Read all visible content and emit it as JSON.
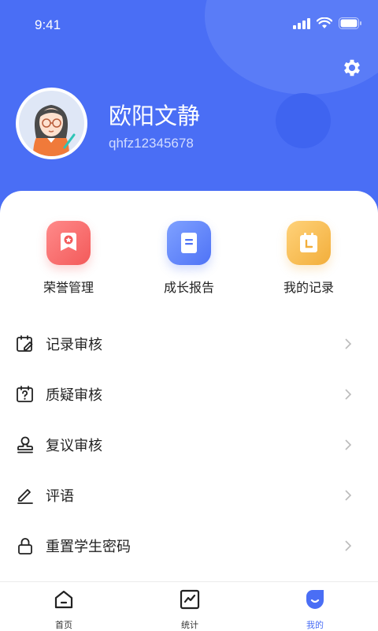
{
  "status": {
    "time": "9:41"
  },
  "profile": {
    "name": "欧阳文静",
    "id": "qhfz12345678"
  },
  "quick_actions": [
    {
      "label": "荣誉管理",
      "icon": "medal-icon",
      "color": "#f35a5a"
    },
    {
      "label": "成长报告",
      "icon": "report-icon",
      "color": "#4f73f6"
    },
    {
      "label": "我的记录",
      "icon": "calendar-icon",
      "color": "#f2ae3b"
    }
  ],
  "menu": [
    {
      "label": "记录审核",
      "icon": "calendar-edit-icon"
    },
    {
      "label": "质疑审核",
      "icon": "question-calendar-icon"
    },
    {
      "label": "复议审核",
      "icon": "stamp-icon"
    },
    {
      "label": "评语",
      "icon": "pen-icon"
    },
    {
      "label": "重置学生密码",
      "icon": "lock-icon"
    }
  ],
  "tabs": [
    {
      "label": "首页",
      "icon": "home-icon"
    },
    {
      "label": "统计",
      "icon": "chart-icon"
    },
    {
      "label": "我的",
      "icon": "profile-icon",
      "active": true
    }
  ],
  "colors": {
    "primary": "#4a6ef5"
  }
}
